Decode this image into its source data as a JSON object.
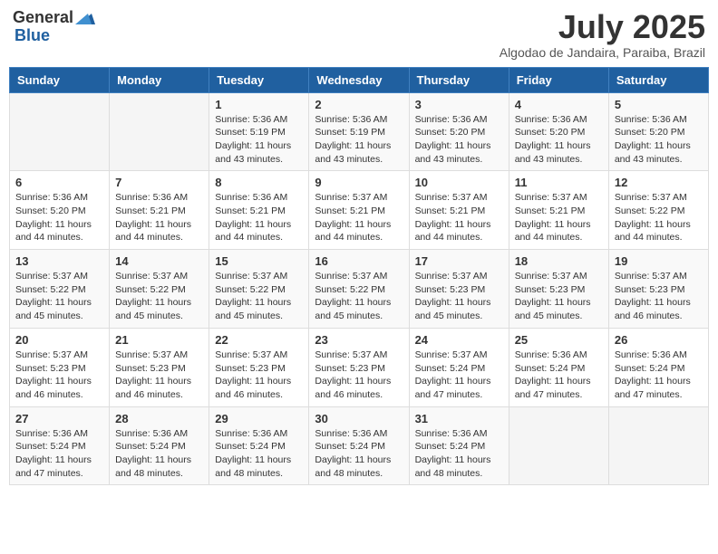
{
  "header": {
    "logo_general": "General",
    "logo_blue": "Blue",
    "month_title": "July 2025",
    "subtitle": "Algodao de Jandaira, Paraiba, Brazil"
  },
  "days_of_week": [
    "Sunday",
    "Monday",
    "Tuesday",
    "Wednesday",
    "Thursday",
    "Friday",
    "Saturday"
  ],
  "weeks": [
    [
      {
        "day": "",
        "sunrise": "",
        "sunset": "",
        "daylight": ""
      },
      {
        "day": "",
        "sunrise": "",
        "sunset": "",
        "daylight": ""
      },
      {
        "day": "1",
        "sunrise": "Sunrise: 5:36 AM",
        "sunset": "Sunset: 5:19 PM",
        "daylight": "Daylight: 11 hours and 43 minutes."
      },
      {
        "day": "2",
        "sunrise": "Sunrise: 5:36 AM",
        "sunset": "Sunset: 5:19 PM",
        "daylight": "Daylight: 11 hours and 43 minutes."
      },
      {
        "day": "3",
        "sunrise": "Sunrise: 5:36 AM",
        "sunset": "Sunset: 5:20 PM",
        "daylight": "Daylight: 11 hours and 43 minutes."
      },
      {
        "day": "4",
        "sunrise": "Sunrise: 5:36 AM",
        "sunset": "Sunset: 5:20 PM",
        "daylight": "Daylight: 11 hours and 43 minutes."
      },
      {
        "day": "5",
        "sunrise": "Sunrise: 5:36 AM",
        "sunset": "Sunset: 5:20 PM",
        "daylight": "Daylight: 11 hours and 43 minutes."
      }
    ],
    [
      {
        "day": "6",
        "sunrise": "Sunrise: 5:36 AM",
        "sunset": "Sunset: 5:20 PM",
        "daylight": "Daylight: 11 hours and 44 minutes."
      },
      {
        "day": "7",
        "sunrise": "Sunrise: 5:36 AM",
        "sunset": "Sunset: 5:21 PM",
        "daylight": "Daylight: 11 hours and 44 minutes."
      },
      {
        "day": "8",
        "sunrise": "Sunrise: 5:36 AM",
        "sunset": "Sunset: 5:21 PM",
        "daylight": "Daylight: 11 hours and 44 minutes."
      },
      {
        "day": "9",
        "sunrise": "Sunrise: 5:37 AM",
        "sunset": "Sunset: 5:21 PM",
        "daylight": "Daylight: 11 hours and 44 minutes."
      },
      {
        "day": "10",
        "sunrise": "Sunrise: 5:37 AM",
        "sunset": "Sunset: 5:21 PM",
        "daylight": "Daylight: 11 hours and 44 minutes."
      },
      {
        "day": "11",
        "sunrise": "Sunrise: 5:37 AM",
        "sunset": "Sunset: 5:21 PM",
        "daylight": "Daylight: 11 hours and 44 minutes."
      },
      {
        "day": "12",
        "sunrise": "Sunrise: 5:37 AM",
        "sunset": "Sunset: 5:22 PM",
        "daylight": "Daylight: 11 hours and 44 minutes."
      }
    ],
    [
      {
        "day": "13",
        "sunrise": "Sunrise: 5:37 AM",
        "sunset": "Sunset: 5:22 PM",
        "daylight": "Daylight: 11 hours and 45 minutes."
      },
      {
        "day": "14",
        "sunrise": "Sunrise: 5:37 AM",
        "sunset": "Sunset: 5:22 PM",
        "daylight": "Daylight: 11 hours and 45 minutes."
      },
      {
        "day": "15",
        "sunrise": "Sunrise: 5:37 AM",
        "sunset": "Sunset: 5:22 PM",
        "daylight": "Daylight: 11 hours and 45 minutes."
      },
      {
        "day": "16",
        "sunrise": "Sunrise: 5:37 AM",
        "sunset": "Sunset: 5:22 PM",
        "daylight": "Daylight: 11 hours and 45 minutes."
      },
      {
        "day": "17",
        "sunrise": "Sunrise: 5:37 AM",
        "sunset": "Sunset: 5:23 PM",
        "daylight": "Daylight: 11 hours and 45 minutes."
      },
      {
        "day": "18",
        "sunrise": "Sunrise: 5:37 AM",
        "sunset": "Sunset: 5:23 PM",
        "daylight": "Daylight: 11 hours and 45 minutes."
      },
      {
        "day": "19",
        "sunrise": "Sunrise: 5:37 AM",
        "sunset": "Sunset: 5:23 PM",
        "daylight": "Daylight: 11 hours and 46 minutes."
      }
    ],
    [
      {
        "day": "20",
        "sunrise": "Sunrise: 5:37 AM",
        "sunset": "Sunset: 5:23 PM",
        "daylight": "Daylight: 11 hours and 46 minutes."
      },
      {
        "day": "21",
        "sunrise": "Sunrise: 5:37 AM",
        "sunset": "Sunset: 5:23 PM",
        "daylight": "Daylight: 11 hours and 46 minutes."
      },
      {
        "day": "22",
        "sunrise": "Sunrise: 5:37 AM",
        "sunset": "Sunset: 5:23 PM",
        "daylight": "Daylight: 11 hours and 46 minutes."
      },
      {
        "day": "23",
        "sunrise": "Sunrise: 5:37 AM",
        "sunset": "Sunset: 5:23 PM",
        "daylight": "Daylight: 11 hours and 46 minutes."
      },
      {
        "day": "24",
        "sunrise": "Sunrise: 5:37 AM",
        "sunset": "Sunset: 5:24 PM",
        "daylight": "Daylight: 11 hours and 47 minutes."
      },
      {
        "day": "25",
        "sunrise": "Sunrise: 5:36 AM",
        "sunset": "Sunset: 5:24 PM",
        "daylight": "Daylight: 11 hours and 47 minutes."
      },
      {
        "day": "26",
        "sunrise": "Sunrise: 5:36 AM",
        "sunset": "Sunset: 5:24 PM",
        "daylight": "Daylight: 11 hours and 47 minutes."
      }
    ],
    [
      {
        "day": "27",
        "sunrise": "Sunrise: 5:36 AM",
        "sunset": "Sunset: 5:24 PM",
        "daylight": "Daylight: 11 hours and 47 minutes."
      },
      {
        "day": "28",
        "sunrise": "Sunrise: 5:36 AM",
        "sunset": "Sunset: 5:24 PM",
        "daylight": "Daylight: 11 hours and 48 minutes."
      },
      {
        "day": "29",
        "sunrise": "Sunrise: 5:36 AM",
        "sunset": "Sunset: 5:24 PM",
        "daylight": "Daylight: 11 hours and 48 minutes."
      },
      {
        "day": "30",
        "sunrise": "Sunrise: 5:36 AM",
        "sunset": "Sunset: 5:24 PM",
        "daylight": "Daylight: 11 hours and 48 minutes."
      },
      {
        "day": "31",
        "sunrise": "Sunrise: 5:36 AM",
        "sunset": "Sunset: 5:24 PM",
        "daylight": "Daylight: 11 hours and 48 minutes."
      },
      {
        "day": "",
        "sunrise": "",
        "sunset": "",
        "daylight": ""
      },
      {
        "day": "",
        "sunrise": "",
        "sunset": "",
        "daylight": ""
      }
    ]
  ]
}
